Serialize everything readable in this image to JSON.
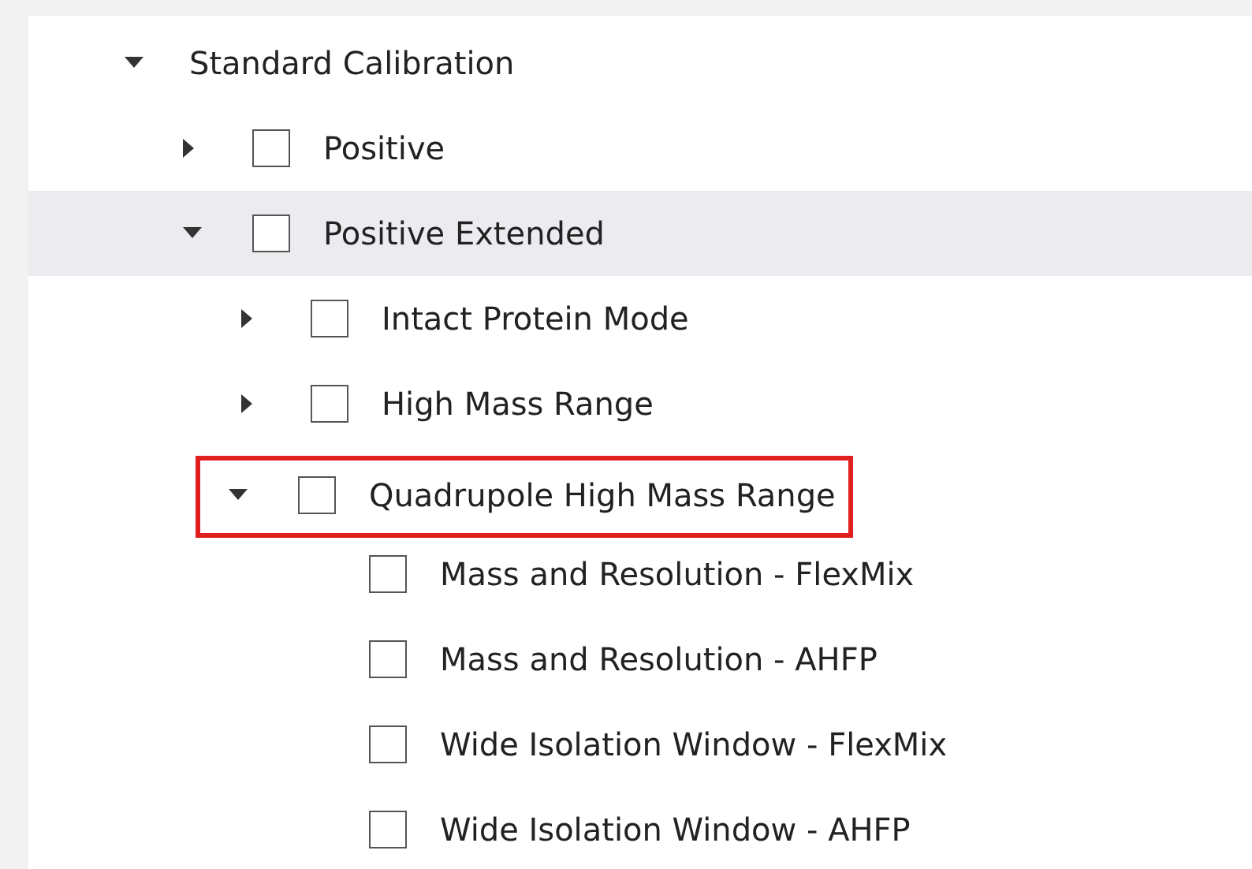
{
  "tree": [
    {
      "label": "Standard Calibration",
      "kind": "header",
      "expanded": true,
      "selected": false,
      "highlighted": false,
      "children": [
        {
          "label": "Positive",
          "kind": "checkbox",
          "checked": false,
          "expanded": false,
          "selected": false,
          "highlighted": false
        },
        {
          "label": "Positive Extended",
          "kind": "checkbox",
          "checked": false,
          "expanded": true,
          "selected": true,
          "highlighted": false,
          "children": [
            {
              "label": "Intact Protein Mode",
              "kind": "checkbox",
              "checked": false,
              "expanded": false,
              "selected": false,
              "highlighted": false
            },
            {
              "label": "High Mass Range",
              "kind": "checkbox",
              "checked": false,
              "expanded": false,
              "selected": false,
              "highlighted": false
            },
            {
              "label": "Quadrupole High Mass Range",
              "kind": "checkbox",
              "checked": false,
              "expanded": true,
              "selected": false,
              "highlighted": true,
              "children": [
                {
                  "label": "Mass and Resolution - FlexMix",
                  "kind": "checkbox",
                  "checked": false,
                  "selected": false,
                  "highlighted": false
                },
                {
                  "label": "Mass and Resolution - AHFP",
                  "kind": "checkbox",
                  "checked": false,
                  "selected": false,
                  "highlighted": false
                },
                {
                  "label": "Wide Isolation Window - FlexMix",
                  "kind": "checkbox",
                  "checked": false,
                  "selected": false,
                  "highlighted": false
                },
                {
                  "label": "Wide Isolation Window - AHFP",
                  "kind": "checkbox",
                  "checked": false,
                  "selected": false,
                  "highlighted": false
                }
              ]
            }
          ]
        }
      ]
    }
  ]
}
